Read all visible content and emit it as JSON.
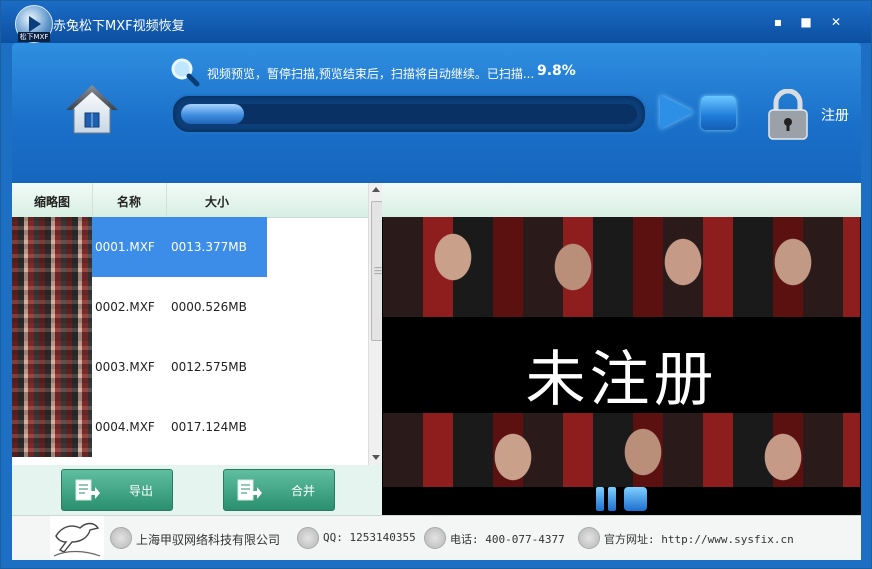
{
  "window": {
    "title": "赤兔松下MXF视频恢复",
    "icon_badge": "松下MXF",
    "minimize": "▪",
    "maximize": "■",
    "close": "✕"
  },
  "header": {
    "status_text": "视频预览，暂停扫描,预览结束后，扫描将自动继续。已扫描...",
    "progress_percent": "9.8%",
    "progress_value": 0.098,
    "register_label": "注册"
  },
  "table": {
    "columns": [
      "缩略图",
      "名称",
      "大小"
    ],
    "rows": [
      {
        "name": "0001.MXF",
        "size": "0013.377MB",
        "selected": true
      },
      {
        "name": "0002.MXF",
        "size": "0000.526MB",
        "selected": false
      },
      {
        "name": "0003.MXF",
        "size": "0012.575MB",
        "selected": false
      },
      {
        "name": "0004.MXF",
        "size": "0017.124MB",
        "selected": false
      }
    ]
  },
  "actions": {
    "export_label": "导出",
    "merge_label": "合并"
  },
  "preview": {
    "watermark": "未注册"
  },
  "footer": {
    "company": "上海甲驭网络科技有限公司",
    "qq": "QQ: 1253140355",
    "phone": "电话: 400-077-4377",
    "website": "官方网址: http://www.sysfix.cn"
  }
}
